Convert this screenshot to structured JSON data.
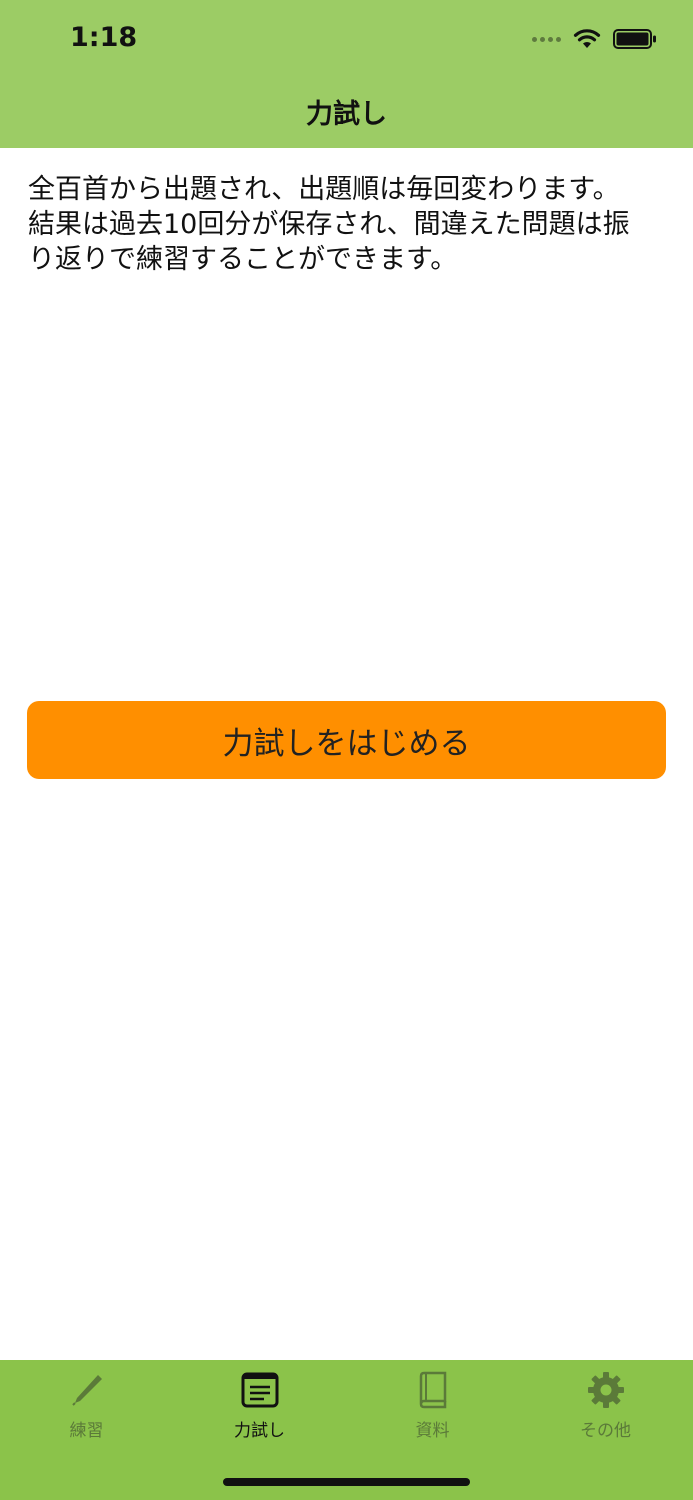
{
  "status_bar": {
    "time": "1:18"
  },
  "nav": {
    "title": "力試し"
  },
  "description": {
    "line1": "全百首から出題され、出題順は毎回変わります。",
    "line2": "結果は過去10回分が保存され、間違えた問題は振",
    "line3": "り返りで練習することができます。"
  },
  "start_button": {
    "label": "力試しをはじめる"
  },
  "tabs": [
    {
      "label": "練習",
      "icon": "pencil-icon",
      "active": false
    },
    {
      "label": "力試し",
      "icon": "list-icon",
      "active": true
    },
    {
      "label": "資料",
      "icon": "book-icon",
      "active": false
    },
    {
      "label": "その他",
      "icon": "gear-icon",
      "active": false
    }
  ],
  "colors": {
    "header_bg": "#9ccc65",
    "tabbar_bg": "#8bc34a",
    "button_bg": "#ff8f00",
    "tab_inactive": "#5b7a39",
    "tab_active": "#111111"
  }
}
